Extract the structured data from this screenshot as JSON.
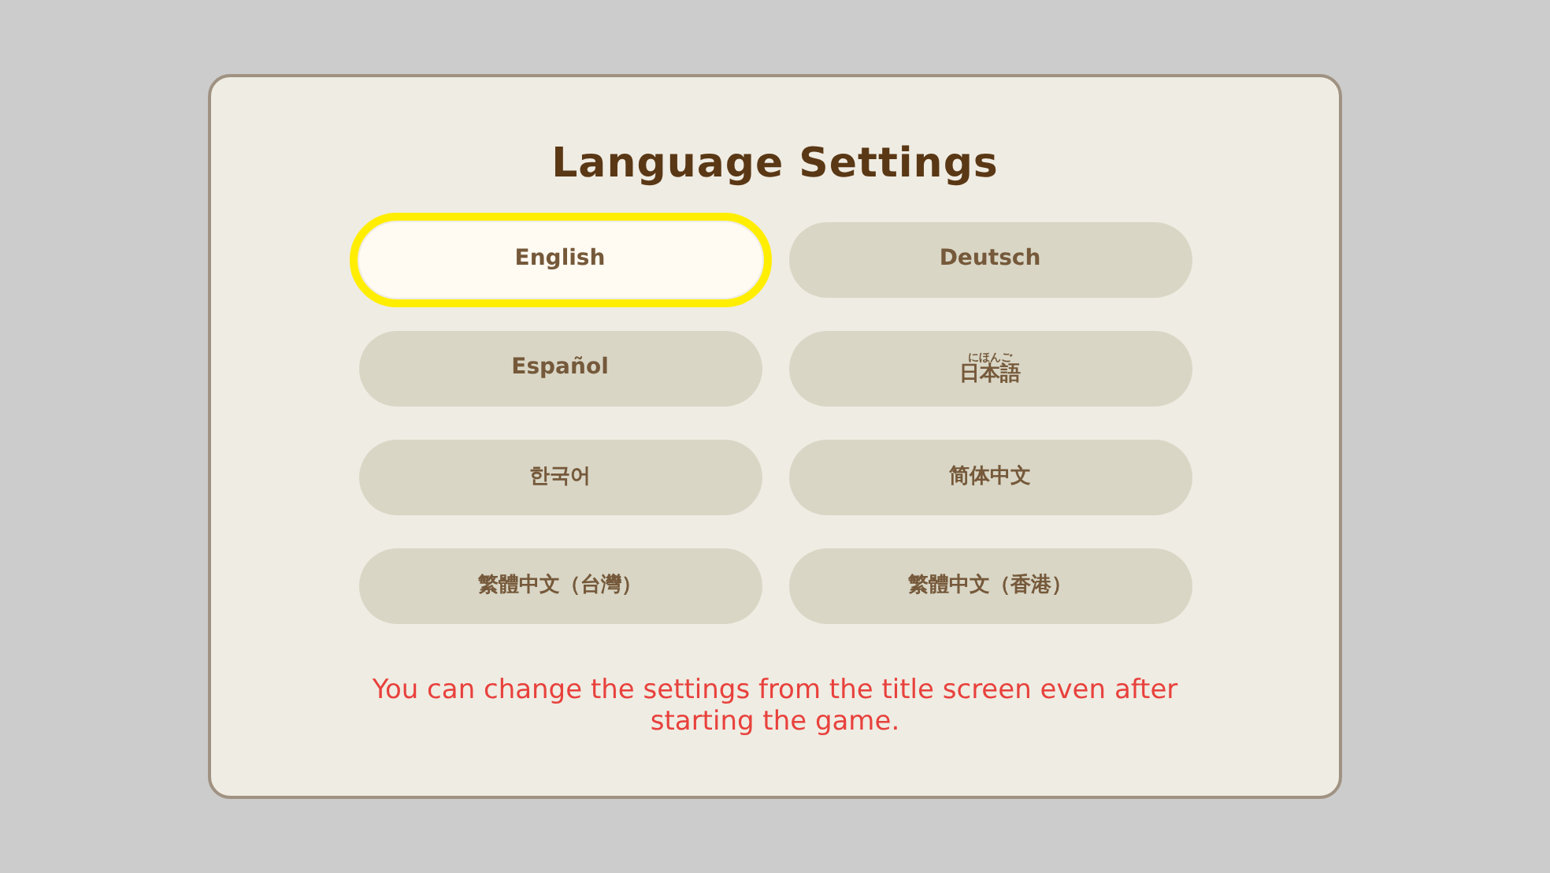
{
  "title": "Language Settings",
  "languages": [
    {
      "label": "English",
      "selected": true
    },
    {
      "label": "Deutsch",
      "selected": false
    },
    {
      "label": "Español",
      "selected": false
    },
    {
      "label": "日本語",
      "ruby": "にほんご",
      "selected": false
    },
    {
      "label": "한국어",
      "selected": false
    },
    {
      "label": "简体中文",
      "selected": false
    },
    {
      "label": "繁體中文（台灣）",
      "selected": false
    },
    {
      "label": "繁體中文（香港）",
      "selected": false
    }
  ],
  "note": "You can change the settings from the title screen even after starting the game."
}
